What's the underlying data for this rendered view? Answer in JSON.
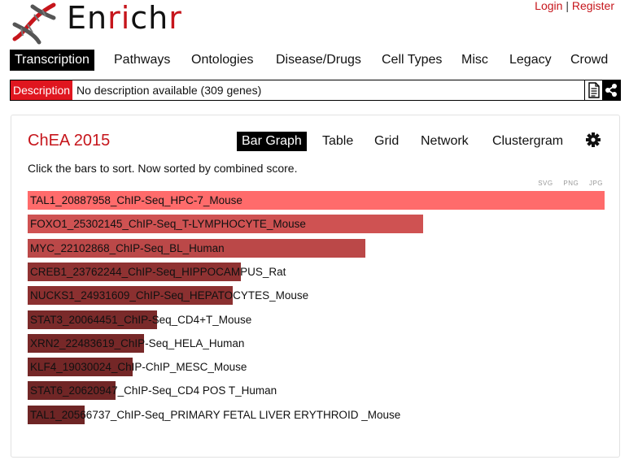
{
  "header": {
    "logo_text_prefix": "En",
    "logo_text_highlight": "ri",
    "logo_text_mid": "ch",
    "logo_text_suffix": "r",
    "login_label": "Login",
    "separator": "|",
    "register_label": "Register",
    "logo_icon": "dna-helix-icon"
  },
  "nav": {
    "items": [
      {
        "label": "Transcription",
        "active": true
      },
      {
        "label": "Pathways"
      },
      {
        "label": "Ontologies"
      },
      {
        "label": "Disease/Drugs"
      },
      {
        "label": "Cell Types"
      },
      {
        "label": "Misc"
      },
      {
        "label": "Legacy"
      },
      {
        "label": "Crowd"
      }
    ]
  },
  "description": {
    "label": "Description",
    "text": "No description available (309 genes)",
    "icons": [
      "document-icon",
      "share-icon"
    ]
  },
  "panel": {
    "library_title": "ChEA 2015",
    "tabs": [
      {
        "label": "Bar Graph",
        "active": true
      },
      {
        "label": "Table"
      },
      {
        "label": "Grid"
      },
      {
        "label": "Network"
      },
      {
        "label": "Clustergram"
      }
    ],
    "settings_icon": "gear-icon",
    "hint": "Click the bars to sort. Now sorted by combined score.",
    "exports": [
      "SVG",
      "PNG",
      "JPG"
    ]
  },
  "chart_data": {
    "type": "bar",
    "orientation": "horizontal",
    "sort": "combined score",
    "categories": [
      "TAL1_20887958_ChIP-Seq_HPC-7_Mouse",
      "FOXO1_25302145_ChIP-Seq_T-LYMPHOCYTE_Mouse",
      "MYC_22102868_ChIP-Seq_BL_Human",
      "CREB1_23762244_ChIP-Seq_HIPPOCAMPUS_Rat",
      "NUCKS1_24931609_ChIP-Seq_HEPATOCYTES_Mouse",
      "STAT3_20064451_ChIP-Seq_CD4+T_Mouse",
      "XRN2_22483619_ChIP-Seq_HELA_Human",
      "KLF4_19030024_ChIP-ChIP_MESC_Mouse",
      "STAT6_20620947_ChIP-Seq_CD4 POS T_Human",
      "TAL1_20566737_ChIP-Seq_PRIMARY FETAL LIVER ERYTHROID _Mouse"
    ],
    "values": [
      1.0,
      0.685,
      0.586,
      0.37,
      0.355,
      0.224,
      0.201,
      0.182,
      0.152,
      0.099
    ],
    "colors": [
      "#ff6b6b",
      "#cf5252",
      "#bb4848",
      "#8f3232",
      "#8b3030",
      "#7a2a2a",
      "#772828",
      "#742727",
      "#702626",
      "#6e2525"
    ]
  }
}
